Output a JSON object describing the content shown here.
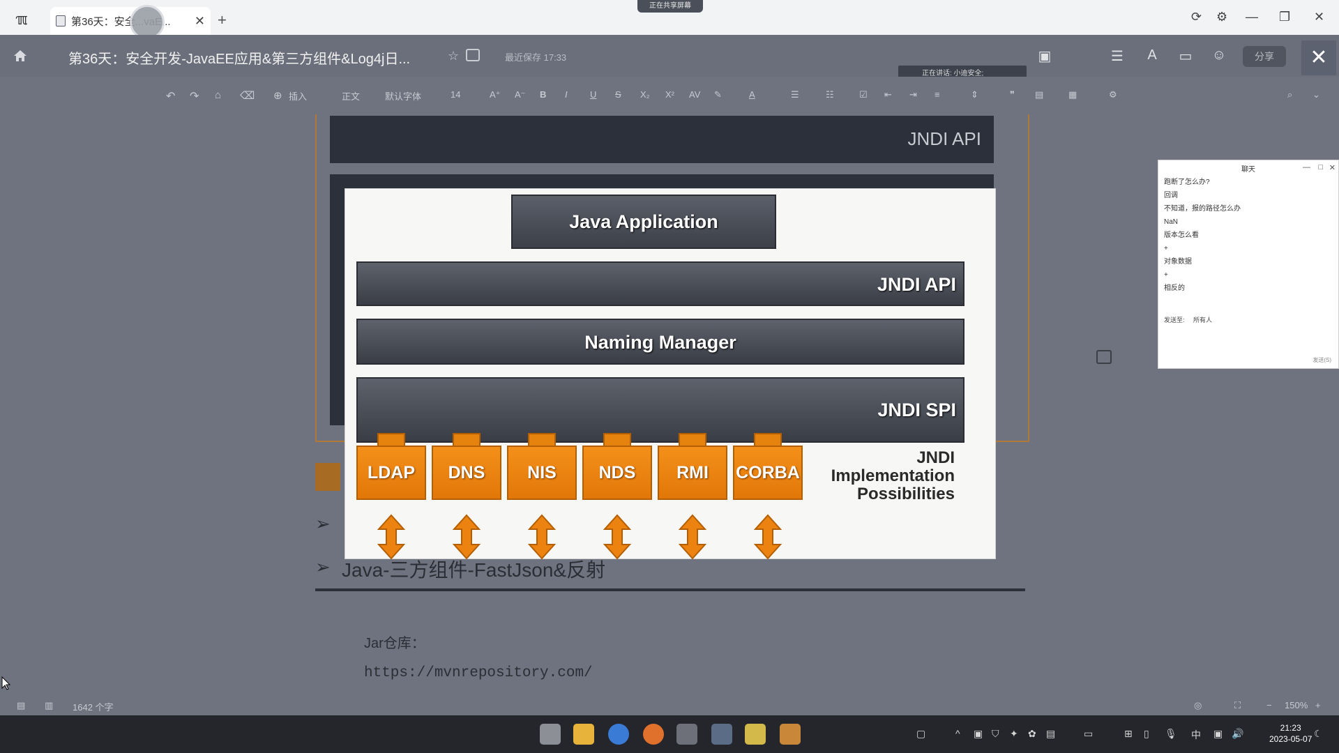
{
  "titlebar": {
    "tab_label": "第36天：安全...vaE...",
    "share_status": "正在共享屏幕",
    "new_tab": "+",
    "close_symbol": "✕"
  },
  "docheader": {
    "title": "第36天：安全开发-JavaEE应用&第三方组件&Log4j日...",
    "save_status": "最近保存 17:33",
    "speaking": "正在讲话: 小迪安全;",
    "share_button": "分享"
  },
  "toolbar": {
    "insert": "插入",
    "style": "正文",
    "font": "默认字体",
    "font_size": "14"
  },
  "document": {
    "band_title": "JNDI API",
    "bullet_text": "Java-三方组件-FastJson&反射",
    "repo_label": "Jar仓库：",
    "repo_url": "https://mvnrepository.com/"
  },
  "slide": {
    "java_application": "Java Application",
    "jndi_api": "JNDI API",
    "naming_manager": "Naming Manager",
    "jndi_spi": "JNDI SPI",
    "providers": [
      "LDAP",
      "DNS",
      "NIS",
      "NDS",
      "RMI",
      "CORBA"
    ],
    "impl_line1": "JNDI",
    "impl_line2": "Implementation",
    "impl_line3": "Possibilities",
    "colors": {
      "provider": "#f08a14",
      "bar": "#4a4e57"
    }
  },
  "chat": {
    "title": "聊天",
    "messages": [
      "跑断了怎么办?",
      "回调",
      "不知道，报的路径怎么办",
      "NaN",
      "版本怎么看",
      "+",
      "对象数据",
      "+",
      "相反的"
    ],
    "send_to_label": "发送至:",
    "send_to_value": "所有人",
    "bottom_text": "发送(S)"
  },
  "statusbar": {
    "word_count": "1642 个字",
    "zoom": "150%"
  },
  "taskbar": {
    "time": "21:23",
    "date": "2023-05-07",
    "ime": "中"
  }
}
